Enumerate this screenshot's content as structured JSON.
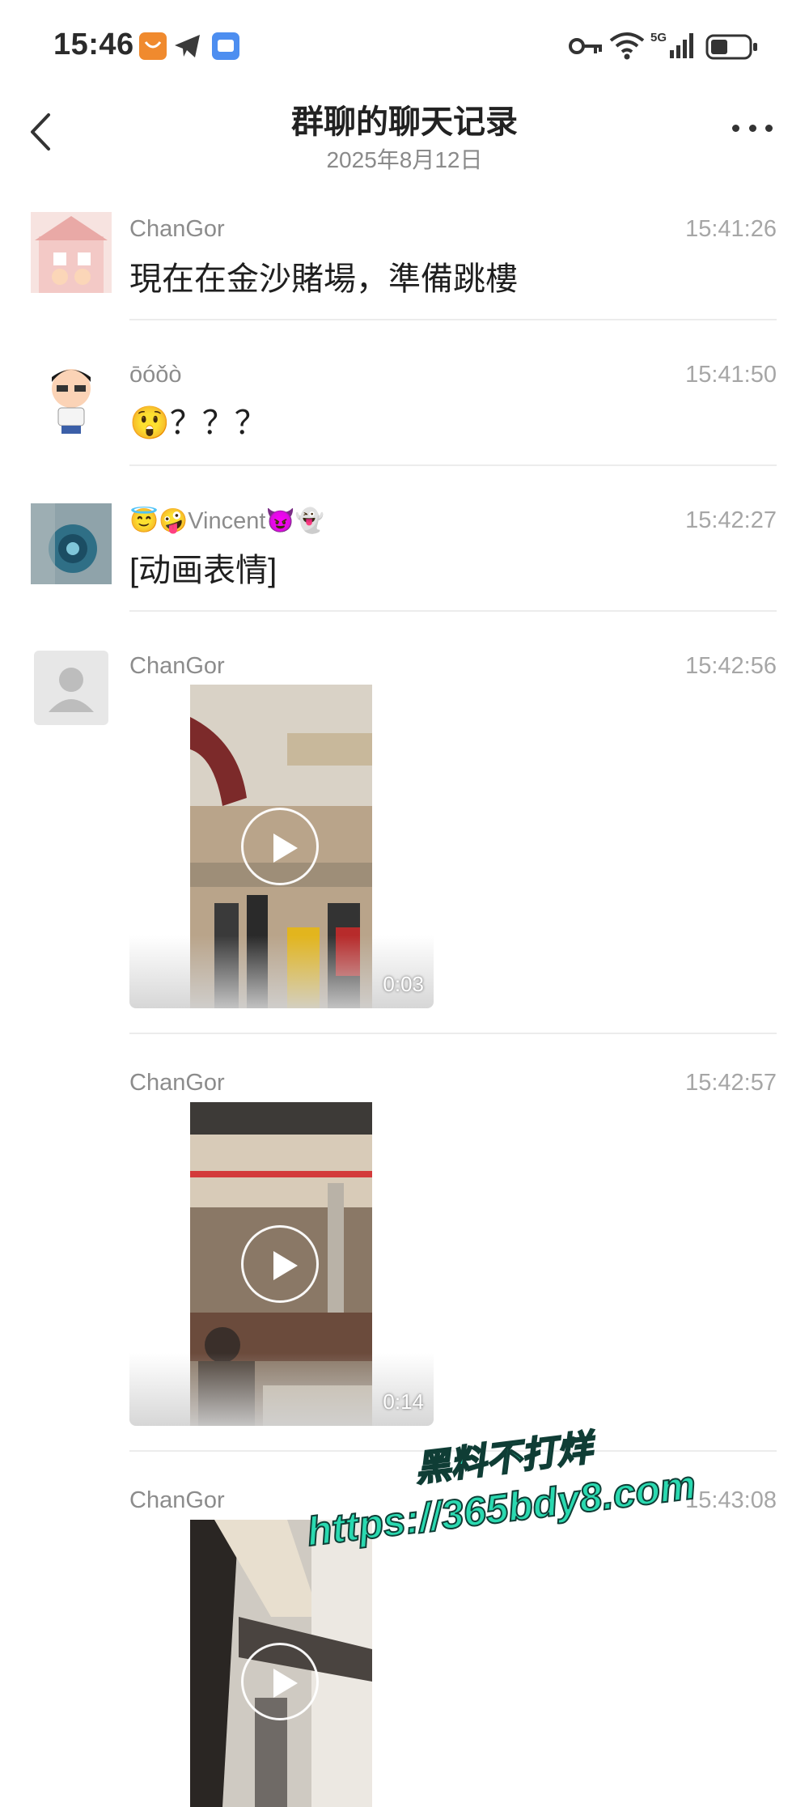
{
  "status_bar": {
    "time": "15:46",
    "icons": [
      "app-notification-icon",
      "telegram-icon",
      "message-app-icon",
      "key-icon",
      "wifi-icon",
      "5g-signal-icon",
      "battery-icon"
    ]
  },
  "header": {
    "title": "群聊的聊天记录",
    "date": "2025年8月12日"
  },
  "messages": [
    {
      "sender": "ChanGor",
      "time": "15:41:26",
      "text": "現在在金沙賭場，準備跳樓"
    },
    {
      "sender": "ōóǒò",
      "time": "15:41:50",
      "text": "？？？",
      "emoji": "😲"
    },
    {
      "sender": "Vincent",
      "sender_prefix": "😇🤪",
      "sender_suffix": "😈👻",
      "time": "15:42:27",
      "text": "[动画表情]"
    },
    {
      "sender": "ChanGor",
      "time": "15:42:56",
      "video_duration": "0:03"
    },
    {
      "sender": "ChanGor",
      "time": "15:42:57",
      "video_duration": "0:14"
    },
    {
      "sender": "ChanGor",
      "time": "15:43:08"
    }
  ],
  "watermark": {
    "line1": "黑料不打烊",
    "line2": "https://365bdy8.com"
  },
  "colors": {
    "accent_watermark": "#2ad9b0",
    "divider": "#ececec",
    "meta_text": "#8c8c8c"
  }
}
